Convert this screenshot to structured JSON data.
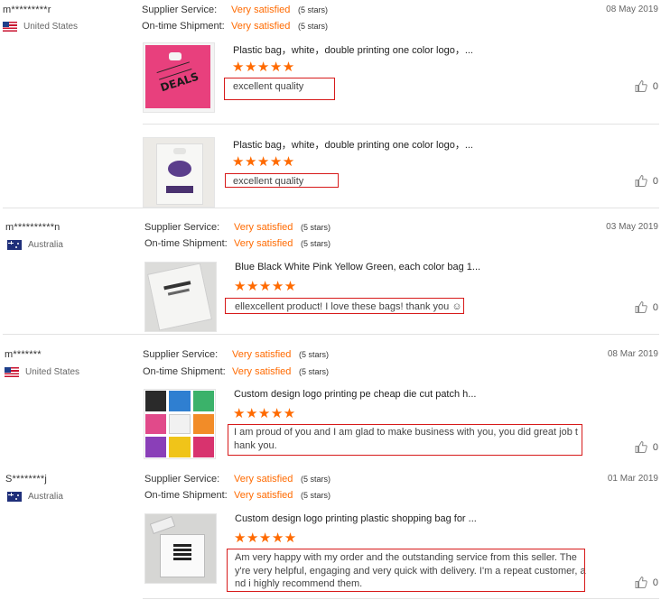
{
  "reviews": [
    {
      "user": "m*********r",
      "country": "United States",
      "date": "08 May 2019",
      "supplier_label": "Supplier Service:",
      "supplier_value": "Very satisfied",
      "supplier_stars": "(5 stars)",
      "shipment_label": "On-time Shipment:",
      "shipment_value": "Very satisfied",
      "shipment_stars": "(5 stars)",
      "items": [
        {
          "title": "Plastic bag，white，double printing one color logo，...",
          "stars": "★★★★★",
          "comment": "excellent quality",
          "likes": "0",
          "thumb_text": "DEALS"
        },
        {
          "title": "Plastic bag，white，double printing one color logo，...",
          "stars": "★★★★★",
          "comment": "excellent quality",
          "likes": "0"
        }
      ]
    },
    {
      "user": "m**********n",
      "country": "Australia",
      "date": "03 May 2019",
      "supplier_label": "Supplier Service:",
      "supplier_value": "Very satisfied",
      "supplier_stars": "(5 stars)",
      "shipment_label": "On-time Shipment:",
      "shipment_value": "Very satisfied",
      "shipment_stars": "(5 stars)",
      "items": [
        {
          "title": "Blue Black White Pink Yellow Green, each color bag 1...",
          "stars": "★★★★★",
          "comment": "ellexcellent product! I love these bags! thank you ☺",
          "likes": "0"
        }
      ]
    },
    {
      "user": "m*******",
      "country": "United States",
      "date": "08 Mar 2019",
      "supplier_label": "Supplier Service:",
      "supplier_value": "Very satisfied",
      "supplier_stars": "(5 stars)",
      "shipment_label": "On-time Shipment:",
      "shipment_value": "Very satisfied",
      "shipment_stars": "(5 stars)",
      "items": [
        {
          "title": "Custom design logo printing pe cheap die cut patch h...",
          "stars": "★★★★★",
          "comment_lines": [
            "I am proud of you and I am glad to make business with you, you did great job t",
            "hank you."
          ],
          "likes": "0"
        }
      ]
    },
    {
      "user": "S********j",
      "country": "Australia",
      "date": "01 Mar 2019",
      "supplier_label": "Supplier Service:",
      "supplier_value": "Very satisfied",
      "supplier_stars": "(5 stars)",
      "shipment_label": "On-time Shipment:",
      "shipment_value": "Very satisfied",
      "shipment_stars": "(5 stars)",
      "items": [
        {
          "title": "Custom design logo printing plastic shopping bag for ...",
          "stars": "★★★★★",
          "comment_lines": [
            "Am very happy with my order and the outstanding service from this seller. The",
            "y're very helpful, engaging and very quick with delivery. I'm a repeat customer, a",
            "nd i highly recommend them."
          ],
          "likes": "0"
        }
      ]
    }
  ],
  "colors": {
    "accent": "#ff6a00",
    "annotation": "#d71a1a",
    "divider": "#e2e2e2"
  },
  "icons": {
    "like": "thumbs-up-icon",
    "flag_us": "us-flag-icon",
    "flag_au": "au-flag-icon"
  }
}
